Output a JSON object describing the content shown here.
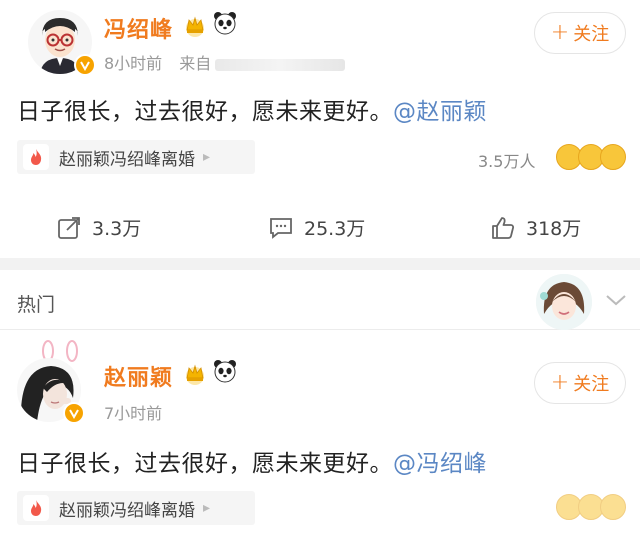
{
  "post1": {
    "username": "冯绍峰",
    "time": "8小时前",
    "source_prefix": "来自",
    "follow_label": "关注",
    "content_text": "日子很长，过去很好，愿未来更好。",
    "mention": "@赵丽颖",
    "topic": "赵丽颖冯绍峰离婚",
    "heat": "3.5万人",
    "repost_count": "3.3万",
    "comment_count": "25.3万",
    "like_count": "318万"
  },
  "hot_section": {
    "label": "热门"
  },
  "post2": {
    "username": "赵丽颖",
    "time": "7小时前",
    "follow_label": "关注",
    "content_text": "日子很长，过去很好，愿未来更好。",
    "mention": "@冯绍峰",
    "topic": "赵丽颖冯绍峰离婚"
  },
  "colors": {
    "username": "#f07b1f",
    "mention": "#5b87c4",
    "verified_badge": "#f7a300"
  },
  "icons": [
    "crown-icon",
    "panda-icon",
    "verified-icon",
    "fire-icon",
    "repost-icon",
    "comment-icon",
    "like-icon",
    "chevron-down-icon"
  ]
}
